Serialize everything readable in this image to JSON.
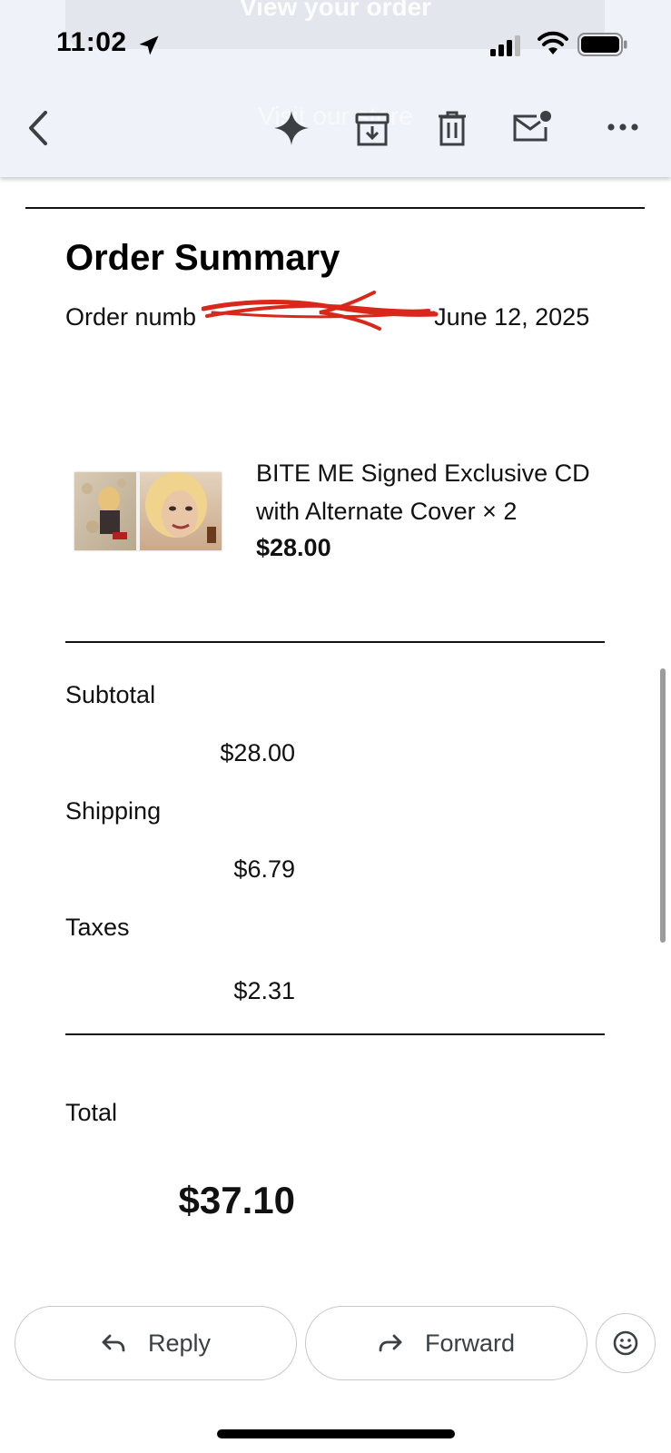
{
  "status_bar": {
    "time": "11:02",
    "icons": [
      "location-arrow-icon",
      "cellular-signal-icon",
      "wifi-icon",
      "battery-icon"
    ]
  },
  "app_bar": {
    "background_buttons": [
      "View your order",
      "Visit our store"
    ],
    "icons": [
      "back-arrow-icon",
      "gemini-sparkle-icon",
      "archive-icon",
      "trash-icon",
      "mark-unread-icon",
      "more-vertical-icon"
    ]
  },
  "email": {
    "title": "Order Summary",
    "order_line_prefix": "Order numb",
    "order_line_suffix": "June 12, 2025",
    "item": {
      "name": "BITE ME Signed Exclusive CD with Alternate Cover × 2",
      "price": "$28.00"
    },
    "summary": {
      "subtotal_label": "Subtotal",
      "subtotal_value": "$28.00",
      "shipping_label": "Shipping",
      "shipping_value": "$6.79",
      "taxes_label": "Taxes",
      "taxes_value": "$2.31",
      "total_label": "Total",
      "total_value": "$37.10"
    }
  },
  "actions": {
    "reply_label": "Reply",
    "forward_label": "Forward",
    "emoji_icon": "emoji-reaction-icon"
  },
  "colors": {
    "app_bar_bg": "#eff2f8",
    "redaction": "#d9271c",
    "text": "#111111"
  }
}
